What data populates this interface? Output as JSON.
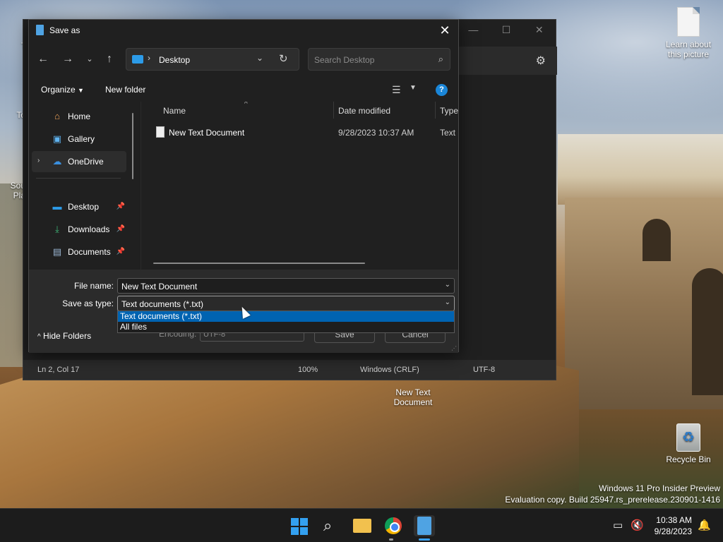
{
  "desktop": {
    "icons": {
      "learn": "Learn about this picture",
      "partial_1": "Th",
      "partial_2": "To",
      "partial_3": "Sou",
      "partial_4": "Pla",
      "new_text_doc": "New Text Document",
      "recycle_bin": "Recycle Bin"
    },
    "watermark": {
      "line1": "Windows 11 Pro Insider Preview",
      "line2": "Evaluation copy. Build 25947.rs_prerelease.230901-1416"
    }
  },
  "notepad": {
    "status": {
      "position": "Ln 2, Col 17",
      "zoom": "100%",
      "line_ending": "Windows (CRLF)",
      "encoding": "UTF-8"
    },
    "caption": {
      "minimize": "—",
      "maximize": "☐",
      "close": "✕"
    }
  },
  "dialog": {
    "title": "Save as",
    "address": {
      "location": "Desktop"
    },
    "search": {
      "placeholder": "Search Desktop"
    },
    "toolbar": {
      "organize": "Organize",
      "new_folder": "New folder"
    },
    "nav": {
      "items": [
        {
          "label": "Home"
        },
        {
          "label": "Gallery"
        },
        {
          "label": "OneDrive"
        },
        {
          "label": "Desktop"
        },
        {
          "label": "Downloads"
        },
        {
          "label": "Documents"
        }
      ]
    },
    "columns": {
      "name": "Name",
      "date": "Date modified",
      "type": "Type"
    },
    "files": [
      {
        "name": "New Text Document",
        "date": "9/28/2023 10:37 AM",
        "type": "Text D"
      }
    ],
    "form": {
      "file_name_label": "File name:",
      "file_name_value": "New Text Document",
      "type_label": "Save as type:",
      "type_value": "Text documents (*.txt)",
      "type_options": [
        "Text documents (*.txt)",
        "All files"
      ],
      "encoding_label": "Encoding:",
      "encoding_value": "UTF-8",
      "save": "Save",
      "cancel": "Cancel",
      "hide_folders": "Hide Folders"
    }
  },
  "taskbar": {
    "time": "10:38 AM",
    "date": "9/28/2023"
  },
  "colors": {
    "accent": "#0063b1",
    "dialog_bg": "#202020",
    "taskbar_bg": "#1c1c1c"
  }
}
